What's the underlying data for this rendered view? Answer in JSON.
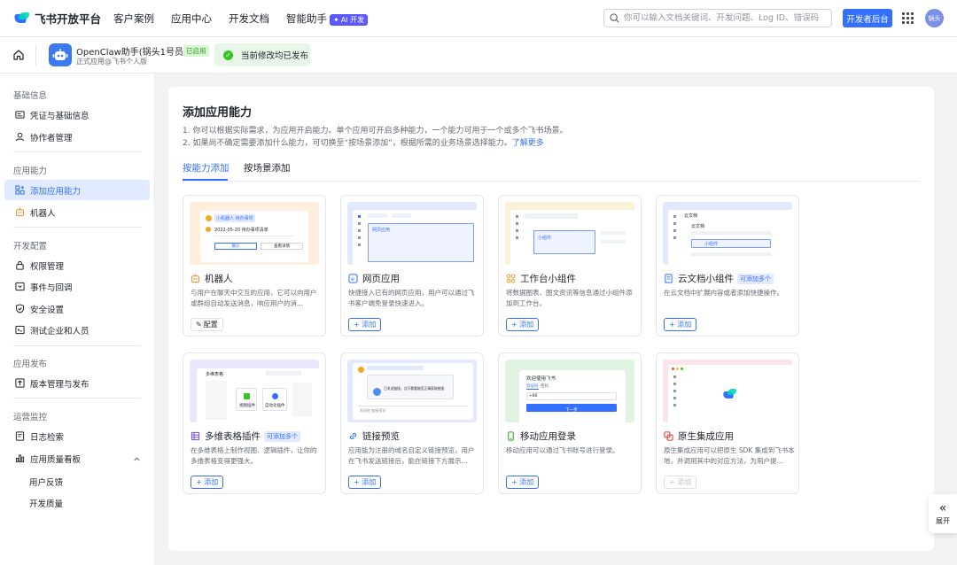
{
  "brand": {
    "name": "飞书开放平台"
  },
  "nav": {
    "items": [
      "客户案例",
      "应用中心",
      "开发文档",
      "智能助手"
    ],
    "ai_badge": "AI 开发"
  },
  "search": {
    "placeholder": "你可以输入文档关键词、开发问题、Log ID、错误码"
  },
  "header": {
    "console_button": "开发者后台",
    "avatar_text": "锅头"
  },
  "app": {
    "name": "OpenClaw助手(锅头1号员工)",
    "status": "已启用",
    "subtitle": "正式应用@飞书个人版",
    "publish_status": "当前修改均已发布"
  },
  "sidebar": {
    "groups": [
      "基础信息",
      "应用能力",
      "开发配置",
      "应用发布",
      "运营监控"
    ],
    "items": [
      "凭证与基础信息",
      "协作者管理",
      "添加应用能力",
      "机器人",
      "权限管理",
      "事件与回调",
      "安全设置",
      "测试企业和人员",
      "版本管理与发布",
      "日志检索",
      "应用质量看板"
    ],
    "subitems": [
      "用户反馈",
      "开发质量"
    ]
  },
  "main": {
    "title": "添加应用能力",
    "desc1": "1. 你可以根据实际需求，为应用开启能力。单个应用可开启多种能力，一个能力可用于一个或多个飞书场景。",
    "desc2": "2. 如果尚不确定需要添加什么能力，可切换至“按场景添加”，根据所需的业务场景选择能力。",
    "learn_more": "了解更多",
    "tabs": [
      "按能力添加",
      "按场景添加"
    ],
    "add_label": "+ 添加",
    "config_label": "配置",
    "multi_badge": "可添加多个",
    "cards": [
      {
        "title": "机器人",
        "desc": "与用户在聊天中交互的应用，它可以向用户或群组自动发送消息，响应用户的消..."
      },
      {
        "title": "网页应用",
        "desc": "快捷接入已有的网页应用，用户可以通过飞书客户端免登录快速进入。"
      },
      {
        "title": "工作台小组件",
        "desc": "将数据图表、图文资讯等信息通过小组件添加到工作台。"
      },
      {
        "title": "云文档小组件",
        "desc": "在云文档中扩展内容或者添加快捷操作。"
      },
      {
        "title": "多维表格插件",
        "desc": "在多维表格上制作视图、逻辑插件，让你的多维表格变得更强大。"
      },
      {
        "title": "链接预览",
        "desc": "应用能为注册的域名自定义链接预览，用户在飞书发送链接后，能在链接下方展示..."
      },
      {
        "title": "移动应用登录",
        "desc": "移动应用可以通过飞书账号进行登录。"
      },
      {
        "title": "原生集成应用",
        "desc": "原生集成应用可以把原生 SDK 集成到飞书本地，并调用其中的对应方法，为用户提..."
      }
    ],
    "thumbs": {
      "bot_chat_name": "小机器人",
      "bot_chat_tag": "待办事项",
      "bot_chat_date": "2022-05-20 待办事项清单",
      "bot_btn1": "确认",
      "bot_btn2": "查看详情",
      "web_tab": "网页应用",
      "widget_label": "小组件",
      "doc_title": "云文档",
      "doc_widget": "小组件",
      "base_title": "多维表格",
      "base_view": "视图插件",
      "base_logic": "自动化插件",
      "preview_msg": "已发送链接，点开看看能否正确获取链接",
      "preview_input": "发送给 链接预览",
      "login_title": "欢迎使用飞书",
      "login_tab1": "验证码",
      "login_tab2": "密码",
      "login_code": "+86",
      "login_btn": "下一步"
    }
  },
  "expand": {
    "label": "展开",
    "arrow": "«"
  }
}
